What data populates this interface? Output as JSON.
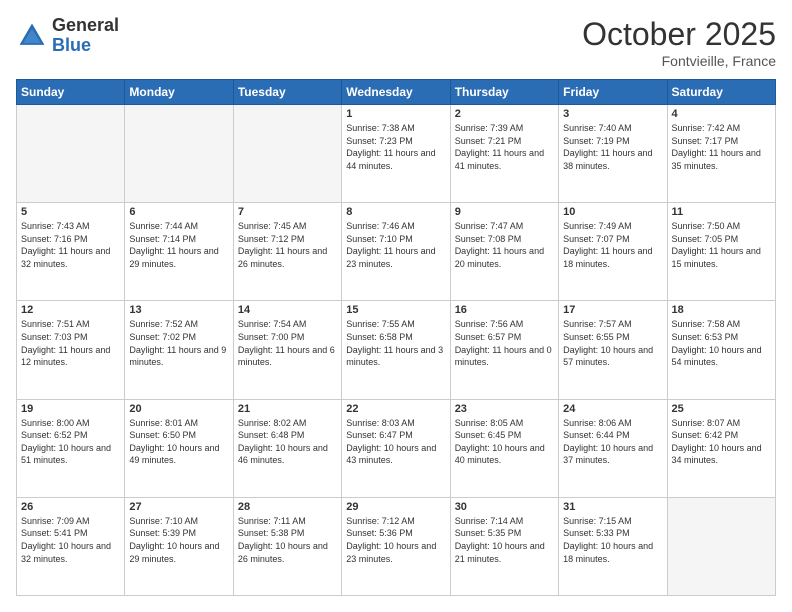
{
  "header": {
    "logo_general": "General",
    "logo_blue": "Blue",
    "month": "October 2025",
    "location": "Fontvieille, France"
  },
  "days_of_week": [
    "Sunday",
    "Monday",
    "Tuesday",
    "Wednesday",
    "Thursday",
    "Friday",
    "Saturday"
  ],
  "weeks": [
    [
      {
        "day": "",
        "empty": true
      },
      {
        "day": "",
        "empty": true
      },
      {
        "day": "",
        "empty": true
      },
      {
        "day": "1",
        "sunrise": "Sunrise: 7:38 AM",
        "sunset": "Sunset: 7:23 PM",
        "daylight": "Daylight: 11 hours and 44 minutes."
      },
      {
        "day": "2",
        "sunrise": "Sunrise: 7:39 AM",
        "sunset": "Sunset: 7:21 PM",
        "daylight": "Daylight: 11 hours and 41 minutes."
      },
      {
        "day": "3",
        "sunrise": "Sunrise: 7:40 AM",
        "sunset": "Sunset: 7:19 PM",
        "daylight": "Daylight: 11 hours and 38 minutes."
      },
      {
        "day": "4",
        "sunrise": "Sunrise: 7:42 AM",
        "sunset": "Sunset: 7:17 PM",
        "daylight": "Daylight: 11 hours and 35 minutes."
      }
    ],
    [
      {
        "day": "5",
        "sunrise": "Sunrise: 7:43 AM",
        "sunset": "Sunset: 7:16 PM",
        "daylight": "Daylight: 11 hours and 32 minutes."
      },
      {
        "day": "6",
        "sunrise": "Sunrise: 7:44 AM",
        "sunset": "Sunset: 7:14 PM",
        "daylight": "Daylight: 11 hours and 29 minutes."
      },
      {
        "day": "7",
        "sunrise": "Sunrise: 7:45 AM",
        "sunset": "Sunset: 7:12 PM",
        "daylight": "Daylight: 11 hours and 26 minutes."
      },
      {
        "day": "8",
        "sunrise": "Sunrise: 7:46 AM",
        "sunset": "Sunset: 7:10 PM",
        "daylight": "Daylight: 11 hours and 23 minutes."
      },
      {
        "day": "9",
        "sunrise": "Sunrise: 7:47 AM",
        "sunset": "Sunset: 7:08 PM",
        "daylight": "Daylight: 11 hours and 20 minutes."
      },
      {
        "day": "10",
        "sunrise": "Sunrise: 7:49 AM",
        "sunset": "Sunset: 7:07 PM",
        "daylight": "Daylight: 11 hours and 18 minutes."
      },
      {
        "day": "11",
        "sunrise": "Sunrise: 7:50 AM",
        "sunset": "Sunset: 7:05 PM",
        "daylight": "Daylight: 11 hours and 15 minutes."
      }
    ],
    [
      {
        "day": "12",
        "sunrise": "Sunrise: 7:51 AM",
        "sunset": "Sunset: 7:03 PM",
        "daylight": "Daylight: 11 hours and 12 minutes."
      },
      {
        "day": "13",
        "sunrise": "Sunrise: 7:52 AM",
        "sunset": "Sunset: 7:02 PM",
        "daylight": "Daylight: 11 hours and 9 minutes."
      },
      {
        "day": "14",
        "sunrise": "Sunrise: 7:54 AM",
        "sunset": "Sunset: 7:00 PM",
        "daylight": "Daylight: 11 hours and 6 minutes."
      },
      {
        "day": "15",
        "sunrise": "Sunrise: 7:55 AM",
        "sunset": "Sunset: 6:58 PM",
        "daylight": "Daylight: 11 hours and 3 minutes."
      },
      {
        "day": "16",
        "sunrise": "Sunrise: 7:56 AM",
        "sunset": "Sunset: 6:57 PM",
        "daylight": "Daylight: 11 hours and 0 minutes."
      },
      {
        "day": "17",
        "sunrise": "Sunrise: 7:57 AM",
        "sunset": "Sunset: 6:55 PM",
        "daylight": "Daylight: 10 hours and 57 minutes."
      },
      {
        "day": "18",
        "sunrise": "Sunrise: 7:58 AM",
        "sunset": "Sunset: 6:53 PM",
        "daylight": "Daylight: 10 hours and 54 minutes."
      }
    ],
    [
      {
        "day": "19",
        "sunrise": "Sunrise: 8:00 AM",
        "sunset": "Sunset: 6:52 PM",
        "daylight": "Daylight: 10 hours and 51 minutes."
      },
      {
        "day": "20",
        "sunrise": "Sunrise: 8:01 AM",
        "sunset": "Sunset: 6:50 PM",
        "daylight": "Daylight: 10 hours and 49 minutes."
      },
      {
        "day": "21",
        "sunrise": "Sunrise: 8:02 AM",
        "sunset": "Sunset: 6:48 PM",
        "daylight": "Daylight: 10 hours and 46 minutes."
      },
      {
        "day": "22",
        "sunrise": "Sunrise: 8:03 AM",
        "sunset": "Sunset: 6:47 PM",
        "daylight": "Daylight: 10 hours and 43 minutes."
      },
      {
        "day": "23",
        "sunrise": "Sunrise: 8:05 AM",
        "sunset": "Sunset: 6:45 PM",
        "daylight": "Daylight: 10 hours and 40 minutes."
      },
      {
        "day": "24",
        "sunrise": "Sunrise: 8:06 AM",
        "sunset": "Sunset: 6:44 PM",
        "daylight": "Daylight: 10 hours and 37 minutes."
      },
      {
        "day": "25",
        "sunrise": "Sunrise: 8:07 AM",
        "sunset": "Sunset: 6:42 PM",
        "daylight": "Daylight: 10 hours and 34 minutes."
      }
    ],
    [
      {
        "day": "26",
        "sunrise": "Sunrise: 7:09 AM",
        "sunset": "Sunset: 5:41 PM",
        "daylight": "Daylight: 10 hours and 32 minutes."
      },
      {
        "day": "27",
        "sunrise": "Sunrise: 7:10 AM",
        "sunset": "Sunset: 5:39 PM",
        "daylight": "Daylight: 10 hours and 29 minutes."
      },
      {
        "day": "28",
        "sunrise": "Sunrise: 7:11 AM",
        "sunset": "Sunset: 5:38 PM",
        "daylight": "Daylight: 10 hours and 26 minutes."
      },
      {
        "day": "29",
        "sunrise": "Sunrise: 7:12 AM",
        "sunset": "Sunset: 5:36 PM",
        "daylight": "Daylight: 10 hours and 23 minutes."
      },
      {
        "day": "30",
        "sunrise": "Sunrise: 7:14 AM",
        "sunset": "Sunset: 5:35 PM",
        "daylight": "Daylight: 10 hours and 21 minutes."
      },
      {
        "day": "31",
        "sunrise": "Sunrise: 7:15 AM",
        "sunset": "Sunset: 5:33 PM",
        "daylight": "Daylight: 10 hours and 18 minutes."
      },
      {
        "day": "",
        "empty": true
      }
    ]
  ]
}
